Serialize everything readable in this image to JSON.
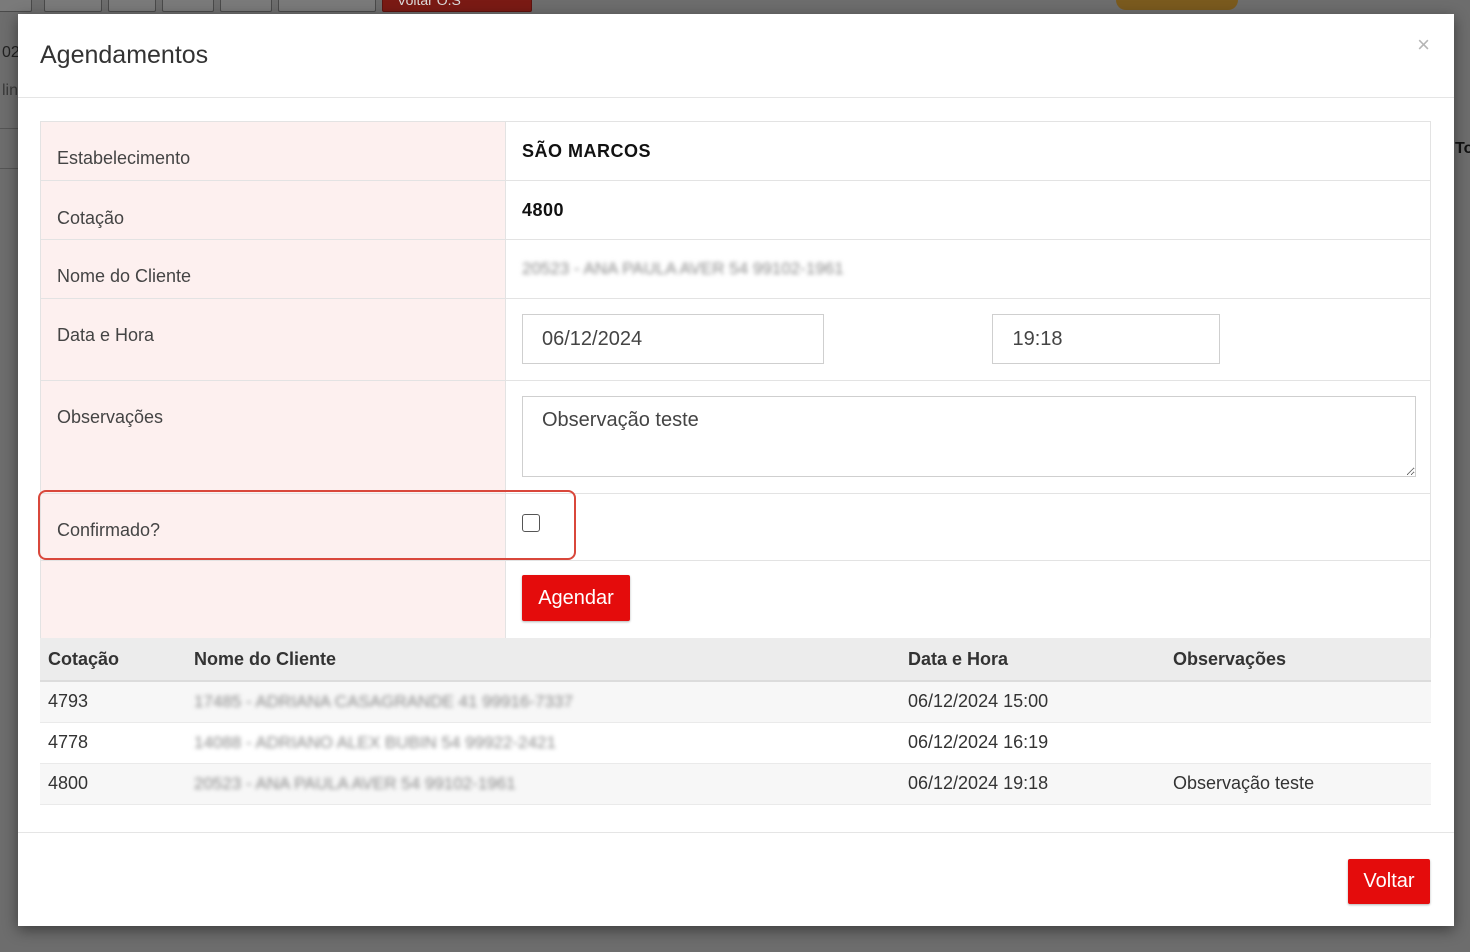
{
  "background": {
    "left_text_a": "02",
    "left_text_b": "lin",
    "right_text": "To",
    "toolbar_btn_label": "Voltar O.S"
  },
  "modal": {
    "title": "Agendamentos",
    "close_glyph": "×"
  },
  "form": {
    "estabelecimento_label": "Estabelecimento",
    "estabelecimento_value": "SÃO MARCOS",
    "cotacao_label": "Cotação",
    "cotacao_value": "4800",
    "cliente_label": "Nome do Cliente",
    "cliente_value": "20523 - ANA PAULA AVER 54 99102-1961",
    "data_hora_label": "Data e Hora",
    "date_value": "06/12/2024",
    "time_value": "19:18",
    "obs_label": "Observações",
    "obs_value": "Observação teste",
    "confirmado_label": "Confirmado?",
    "confirmado_checked": false,
    "submit_label": "Agendar"
  },
  "list": {
    "columns": [
      "Cotação",
      "Nome do Cliente",
      "Data e Hora",
      "Observações"
    ],
    "rows": [
      {
        "cotacao": "4793",
        "cliente": "17485 - ADRIANA CASAGRANDE 41 99916-7337",
        "data_hora": "06/12/2024 15:00",
        "obs": ""
      },
      {
        "cotacao": "4778",
        "cliente": "14088 - ADRIANO ALEX BUBIN 54 99922-2421",
        "data_hora": "06/12/2024 16:19",
        "obs": ""
      },
      {
        "cotacao": "4800",
        "cliente": "20523 - ANA PAULA AVER 54 99102-1961",
        "data_hora": "06/12/2024 19:18",
        "obs": "Observação teste"
      }
    ]
  },
  "footer": {
    "back_label": "Voltar"
  },
  "colors": {
    "accent_red": "#e40c0c",
    "label_bg": "#fdf0ef",
    "highlight_border": "#d9473b"
  }
}
